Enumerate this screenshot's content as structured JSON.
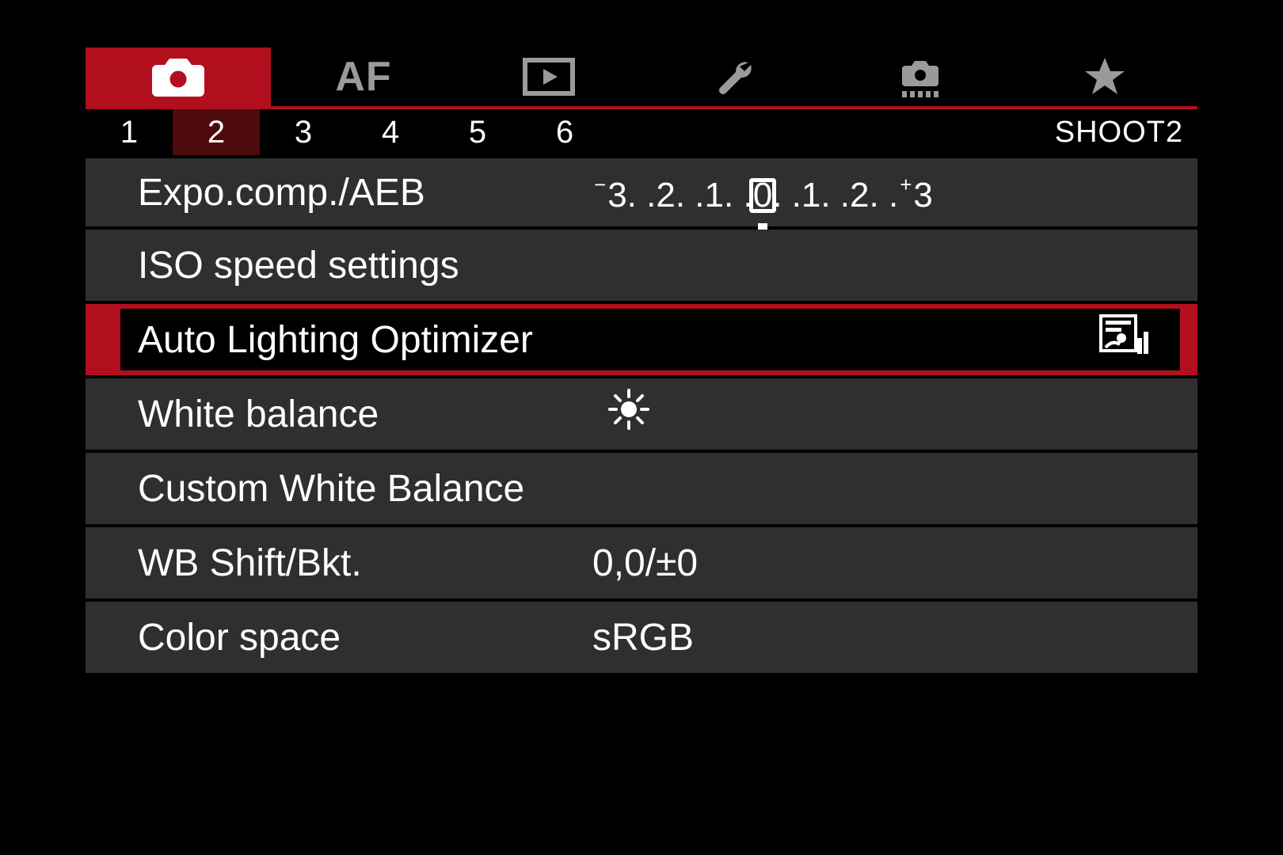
{
  "main_tabs": {
    "active_index": 0,
    "items": [
      {
        "icon": "camera-icon"
      },
      {
        "icon": "af-icon",
        "text": "AF"
      },
      {
        "icon": "play-icon"
      },
      {
        "icon": "wrench-icon"
      },
      {
        "icon": "custom-fn-icon"
      },
      {
        "icon": "star-icon"
      }
    ]
  },
  "sub_tabs": {
    "active_index": 1,
    "pages": [
      "1",
      "2",
      "3",
      "4",
      "5",
      "6"
    ],
    "title": "SHOOT2"
  },
  "expo_scale": {
    "minus": "−",
    "plus": "+",
    "values": [
      "3",
      "2",
      "1",
      "0",
      "1",
      "2",
      "3"
    ],
    "dots": ". ."
  },
  "menu": {
    "items": [
      {
        "label": "Expo.comp./AEB",
        "value_kind": "expo-scale"
      },
      {
        "label": "ISO speed settings"
      },
      {
        "label": "Auto Lighting Optimizer",
        "value_kind": "alo-icon",
        "selected": true
      },
      {
        "label": "White balance",
        "value_kind": "sun-icon"
      },
      {
        "label": "Custom White Balance"
      },
      {
        "label": "WB Shift/Bkt.",
        "value": "0,0/±0"
      },
      {
        "label": "Color space",
        "value": "sRGB"
      }
    ]
  }
}
